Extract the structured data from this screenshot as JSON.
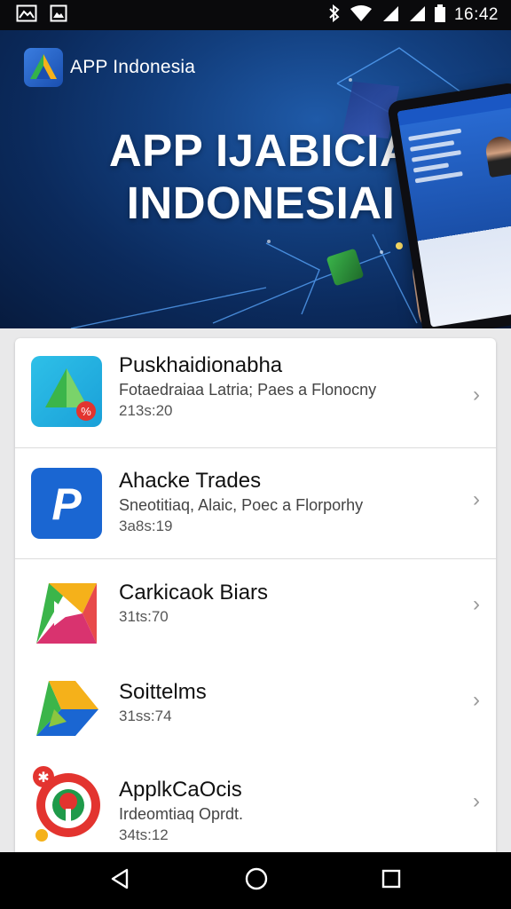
{
  "status_bar": {
    "time": "16:42",
    "left_icons": [
      "gallery-icon",
      "image-icon"
    ],
    "right_icons": [
      "bluetooth-icon",
      "wifi-icon",
      "signal-icon",
      "signal-icon",
      "battery-icon"
    ]
  },
  "hero": {
    "brand_name": "APP Indonesia",
    "title_line1": "APP IJABICIA",
    "title_line2": "INDONESIAI"
  },
  "apps": [
    {
      "name": "Puskhaidionabha",
      "description": "Fotaedraiaa Latria; Paes a Flonocny",
      "meta": "213s:20",
      "icon": "puskha-app-icon"
    },
    {
      "name": "Ahacke Trades",
      "description": "Sneotitiaq, Alaic, Poec a Florporhy",
      "meta": "3a8s:19",
      "icon": "p-app-icon"
    },
    {
      "name": "Carkicaok Biars",
      "description": "",
      "meta": "31ts:70",
      "icon": "arrow-app-icon"
    },
    {
      "name": "Soittelms",
      "description": "",
      "meta": "31ss:74",
      "icon": "arrow-app-icon"
    },
    {
      "name": "ApplkCaOcis",
      "description": "Irdeomtiaq Oprdt.",
      "meta": "34ts:12",
      "icon": "ring-app-icon"
    }
  ],
  "nav": {
    "icons": [
      "back-icon",
      "home-icon",
      "recents-icon"
    ]
  },
  "colors": {
    "hero_bg": "#0b2a5c",
    "accent": "#1a57c4",
    "card_bg": "#ffffff"
  }
}
